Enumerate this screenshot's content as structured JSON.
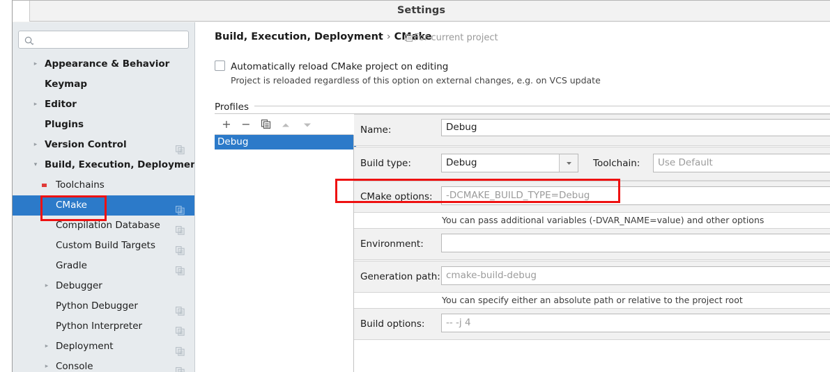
{
  "window": {
    "title": "Settings"
  },
  "sidebar": {
    "search": {
      "value": "",
      "placeholder": ""
    },
    "items": [
      {
        "label": "Appearance & Behavior",
        "arrow": "▸",
        "bold": true,
        "indent": 46,
        "copy": false,
        "selected": false
      },
      {
        "label": "Keymap",
        "arrow": "",
        "bold": true,
        "indent": 46,
        "copy": false,
        "selected": false
      },
      {
        "label": "Editor",
        "arrow": "▸",
        "bold": true,
        "indent": 46,
        "copy": false,
        "selected": false
      },
      {
        "label": "Plugins",
        "arrow": "",
        "bold": true,
        "indent": 46,
        "copy": false,
        "selected": false
      },
      {
        "label": "Version Control",
        "arrow": "▸",
        "bold": true,
        "indent": 46,
        "copy": true,
        "selected": false
      },
      {
        "label": "Build, Execution, Deployment",
        "arrow": "▾",
        "bold": true,
        "indent": 46,
        "copy": false,
        "selected": false
      },
      {
        "label": "Toolchains",
        "arrow": "",
        "bold": false,
        "indent": 62,
        "copy": false,
        "selected": false,
        "marker": "red-square"
      },
      {
        "label": "CMake",
        "arrow": "",
        "bold": false,
        "indent": 62,
        "copy": true,
        "selected": true
      },
      {
        "label": "Compilation Database",
        "arrow": "",
        "bold": false,
        "indent": 62,
        "copy": true,
        "selected": false
      },
      {
        "label": "Custom Build Targets",
        "arrow": "",
        "bold": false,
        "indent": 62,
        "copy": true,
        "selected": false
      },
      {
        "label": "Gradle",
        "arrow": "",
        "bold": false,
        "indent": 62,
        "copy": true,
        "selected": false
      },
      {
        "label": "Debugger",
        "arrow": "▸",
        "bold": false,
        "indent": 62,
        "copy": false,
        "selected": false
      },
      {
        "label": "Python Debugger",
        "arrow": "",
        "bold": false,
        "indent": 62,
        "copy": true,
        "selected": false
      },
      {
        "label": "Python Interpreter",
        "arrow": "",
        "bold": false,
        "indent": 62,
        "copy": true,
        "selected": false
      },
      {
        "label": "Deployment",
        "arrow": "▸",
        "bold": false,
        "indent": 62,
        "copy": true,
        "selected": false
      },
      {
        "label": "Console",
        "arrow": "▸",
        "bold": false,
        "indent": 62,
        "copy": true,
        "selected": false
      }
    ]
  },
  "content": {
    "breadcrumb_root": "Build, Execution, Deployment",
    "breadcrumb_sep": "›",
    "breadcrumb_leaf": "CMake",
    "scope_note": "For current project",
    "auto_reload_label": "Automatically reload CMake project on editing",
    "auto_reload_checked": false,
    "auto_reload_sub": "Project is reloaded regardless of this option on external changes, e.g. on VCS update",
    "profiles_title": "Profiles",
    "toolbar": {
      "add_label": "+",
      "remove_label": "−",
      "copy_label": "copy-icon",
      "up_label": "▲",
      "down_label": "▼"
    },
    "profiles": [
      {
        "name": "Debug",
        "selected": true
      }
    ],
    "form": {
      "name_label": "Name:",
      "name_value": "Debug",
      "build_type_label": "Build type:",
      "build_type_value": "Debug",
      "toolchain_label": "Toolchain:",
      "toolchain_placeholder": "Use Default",
      "cmake_options_label": "CMake options:",
      "cmake_options_placeholder": "-DCMAKE_BUILD_TYPE=Debug",
      "cmake_options_hint": "You can pass additional variables (-DVAR_NAME=value) and other options",
      "environment_label": "Environment:",
      "environment_value": "",
      "generation_path_label": "Generation path:",
      "generation_path_placeholder": "cmake-build-debug",
      "generation_path_hint": "You can specify either an absolute path or relative to the project root",
      "build_options_label": "Build options:",
      "build_options_placeholder": "-- -j 4"
    }
  },
  "annotations": {
    "cmake_sidebar_highlight": "red-rectangle",
    "cmake_options_highlight": "red-rectangle"
  },
  "colors": {
    "accent": "#2c7ac9",
    "annotation": "#ee1111",
    "sidebar_bg": "#e7ebee",
    "titlebar_bg": "#f2f2f2"
  }
}
